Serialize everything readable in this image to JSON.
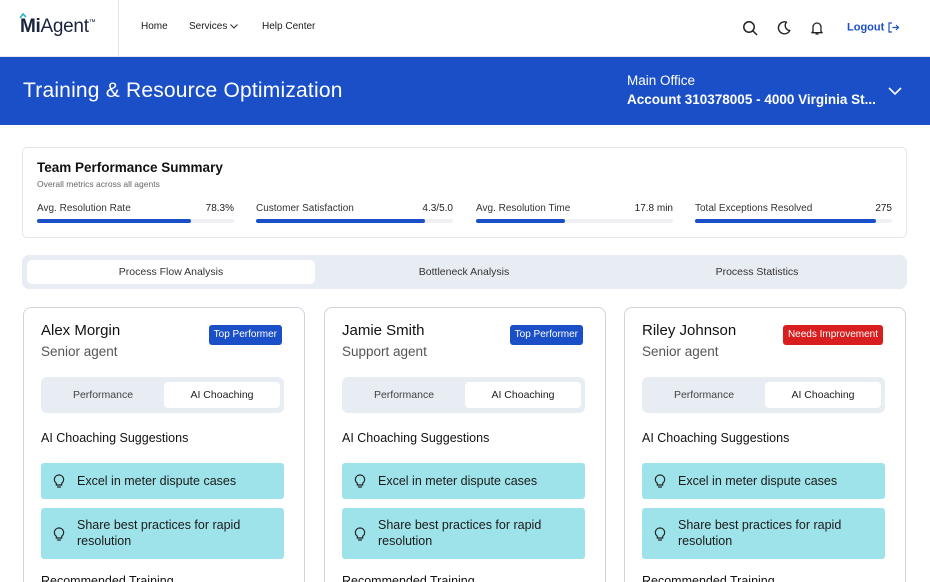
{
  "nav": {
    "logo_mi": "Mi",
    "logo_rest": "Agent",
    "logo_tm": "™",
    "links": [
      "Home",
      "Services",
      "Help Center"
    ],
    "logout": "Logout",
    "icons": [
      "search-icon",
      "moon-icon",
      "bell-icon",
      "logout-icon"
    ]
  },
  "banner": {
    "title": "Training & Resource Optimization",
    "office": "Main Office",
    "account": "Account 310378005 - 4000 Virginia St..."
  },
  "summary": {
    "title": "Team Performance Summary",
    "subtitle": "Overall metrics across all agents",
    "metrics": [
      {
        "label": "Avg. Resolution Rate",
        "value": "78.3%",
        "fill": 0.78
      },
      {
        "label": "Customer Satisfaction",
        "value": "4.3/5.0",
        "fill": 0.86
      },
      {
        "label": "Avg. Resolution Time",
        "value": "17.8 min",
        "fill": 0.45
      },
      {
        "label": "Total Exceptions Resolved",
        "value": "275",
        "fill": 0.92
      }
    ]
  },
  "tabs": {
    "items": [
      "Process Flow Analysis",
      "Bottleneck Analysis",
      "Process Statistics"
    ],
    "active": 0
  },
  "agents": [
    {
      "name": "Alex Morgin",
      "role": "Senior agent",
      "badge": "Top Performer",
      "badge_type": "top",
      "subtabs": [
        "Performance",
        "AI Choaching"
      ],
      "section_title": "AI Choaching Suggestions",
      "suggestions": [
        "Excel in meter dispute cases",
        "Share best practices for rapid resolution"
      ],
      "recommended": "Recommended Training"
    },
    {
      "name": "Jamie Smith",
      "role": "Support agent",
      "badge": "Top Performer",
      "badge_type": "top",
      "subtabs": [
        "Performance",
        "AI Choaching"
      ],
      "section_title": "AI Choaching Suggestions",
      "suggestions": [
        "Excel in meter dispute cases",
        "Share best practices for rapid resolution"
      ],
      "recommended": "Recommended Training"
    },
    {
      "name": "Riley Johnson",
      "role": "Senior agent",
      "badge": "Needs Improvement",
      "badge_type": "needs",
      "subtabs": [
        "Performance",
        "AI Choaching"
      ],
      "section_title": "AI Choaching Suggestions",
      "suggestions": [
        "Excel in meter dispute cases",
        "Share best practices for rapid resolution"
      ],
      "recommended": "Recommended Training"
    }
  ],
  "colors": {
    "brand_blue": "#1a4fc8",
    "badge_red": "#d81e1e",
    "suggestion_bg": "#9fe3ea"
  }
}
